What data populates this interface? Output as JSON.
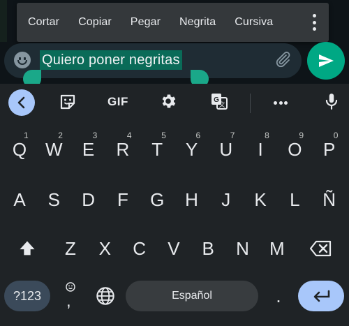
{
  "context_menu": {
    "items": [
      "Cortar",
      "Copiar",
      "Pegar",
      "Negrita",
      "Cursiva"
    ]
  },
  "composer": {
    "text": "Quiero poner negritas"
  },
  "keyboard": {
    "toolbar": {
      "gif_label": "GIF"
    },
    "row1": [
      "Q",
      "W",
      "E",
      "R",
      "T",
      "Y",
      "U",
      "I",
      "O",
      "P"
    ],
    "row1_hints": [
      "1",
      "2",
      "3",
      "4",
      "5",
      "6",
      "7",
      "8",
      "9",
      "0"
    ],
    "row2": [
      "A",
      "S",
      "D",
      "F",
      "G",
      "H",
      "J",
      "K",
      "L",
      "Ñ"
    ],
    "row3": [
      "Z",
      "X",
      "C",
      "V",
      "B",
      "N",
      "M"
    ],
    "symbols_label": "?123",
    "comma_label": ",",
    "space_label": "Español",
    "period_label": "."
  },
  "colors": {
    "accent": "#00a884",
    "selection": "#0a6b58",
    "keyboard_bg": "#1f2326",
    "pill_blue": "#a8c7fa"
  }
}
